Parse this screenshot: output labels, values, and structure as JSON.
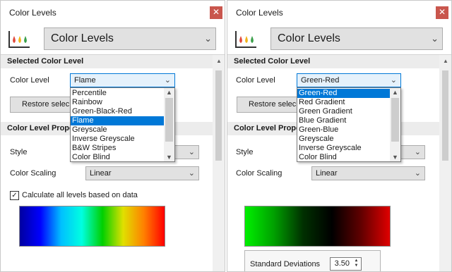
{
  "colors": {
    "accent": "#0078d7",
    "close_button": "#c9564d",
    "section_header": "#ececec"
  },
  "panels": [
    {
      "window_title": "Color Levels",
      "header_select": "Color Levels",
      "section1_title": "Selected Color Level",
      "color_level_label": "Color Level",
      "color_level_value": "Flame",
      "restore_label": "Restore selec",
      "section2_title": "Color Level Prope",
      "style_label": "Style",
      "style_value": "",
      "scaling_label": "Color Scaling",
      "scaling_value": "Linear",
      "checkbox_label": "Calculate all levels based on data",
      "checkbox_checked": true,
      "dropdown_options": [
        "Percentile",
        "Rainbow",
        "Green-Black-Red",
        "Flame",
        "Greyscale",
        "Inverse Greyscale",
        "B&W Stripes",
        "Color Blind"
      ],
      "dropdown_selected": "Flame",
      "gradient_colors": [
        "#0000a0",
        "#0000ff",
        "#00c0ff",
        "#00ffe0",
        "#00d000",
        "#e0e000",
        "#ff8000",
        "#ff0000"
      ]
    },
    {
      "window_title": "Color Levels",
      "header_select": "Color Levels",
      "section1_title": "Selected Color Level",
      "color_level_label": "Color Level",
      "color_level_value": "Green-Red",
      "restore_label": "Restore selec",
      "section2_title": "Color Level Prope",
      "style_label": "Style",
      "style_value": "",
      "scaling_label": "Color Scaling",
      "scaling_value": "Linear",
      "dropdown_options": [
        "Green-Red",
        "Red Gradient",
        "Green Gradient",
        "Blue Gradient",
        "Green-Blue",
        "Greyscale",
        "Inverse Greyscale",
        "Color Blind"
      ],
      "dropdown_selected": "Green-Red",
      "gradient_colors": [
        "#00f000",
        "#00a000",
        "#003000",
        "#000000",
        "#600000",
        "#e00000"
      ],
      "std_dev_label": "Standard Deviations",
      "std_dev_value": "3.50"
    }
  ]
}
